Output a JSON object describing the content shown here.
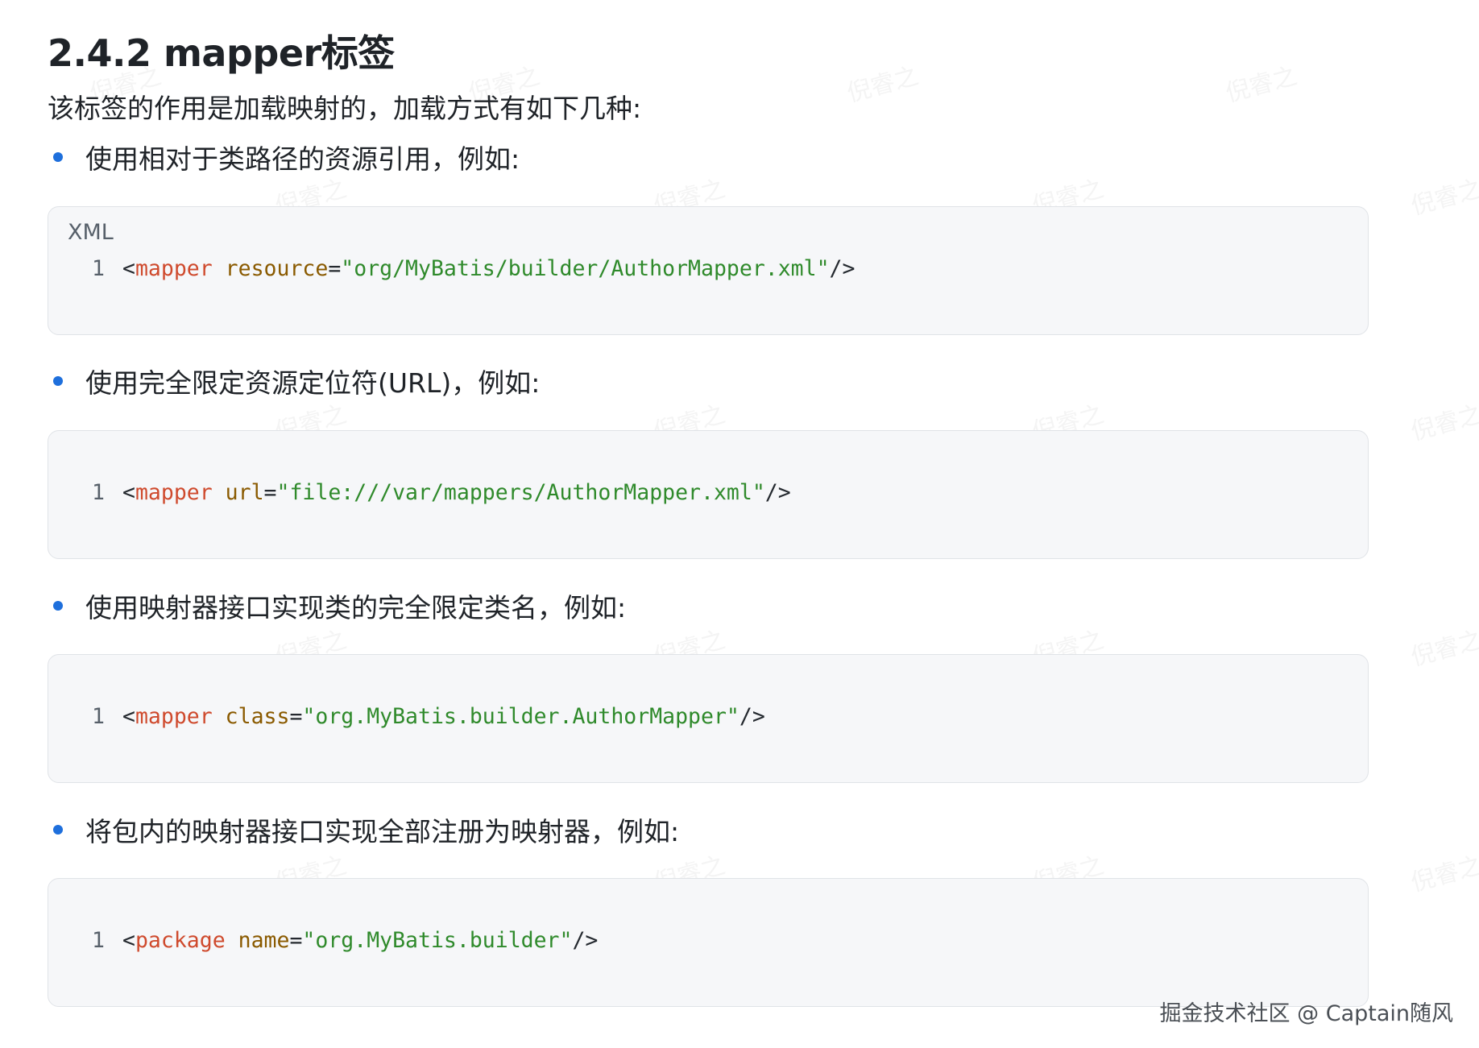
{
  "heading": "2.4.2 mapper标签",
  "intro": "该标签的作用是加载映射的，加载方式有如下几种:",
  "sections": [
    {
      "bullet": "使用相对于类路径的资源引用，例如:",
      "lang": "XML",
      "line_number": "1",
      "code": {
        "open": "<",
        "tag": "mapper",
        "attr": "resource",
        "eq": "=",
        "value": "\"org/MyBatis/builder/AuthorMapper.xml\"",
        "close": "/>"
      }
    },
    {
      "bullet": "使用完全限定资源定位符(URL)，例如:",
      "lang": "",
      "line_number": "1",
      "code": {
        "open": "<",
        "tag": "mapper",
        "attr": "url",
        "eq": "=",
        "value": "\"file:///var/mappers/AuthorMapper.xml\"",
        "close": "/>"
      }
    },
    {
      "bullet": "使用映射器接口实现类的完全限定类名，例如:",
      "lang": "",
      "line_number": "1",
      "code": {
        "open": "<",
        "tag": "mapper",
        "attr": "class",
        "eq": "=",
        "value": "\"org.MyBatis.builder.AuthorMapper\"",
        "close": "/>"
      }
    },
    {
      "bullet": "将包内的映射器接口实现全部注册为映射器，例如:",
      "lang": "",
      "line_number": "1",
      "code": {
        "open": "<",
        "tag": "package",
        "attr": "name",
        "eq": "=",
        "value": "\"org.MyBatis.builder\"",
        "close": "/>"
      }
    }
  ],
  "watermark": "倪睿之",
  "footer": "掘金技术社区 @ Captain随风",
  "colors": {
    "bullet": "#1e6fdc",
    "tag": "#cf4a2d",
    "attr": "#8a5a00",
    "string": "#2f8a2b",
    "code_bg": "#f6f7f9"
  }
}
